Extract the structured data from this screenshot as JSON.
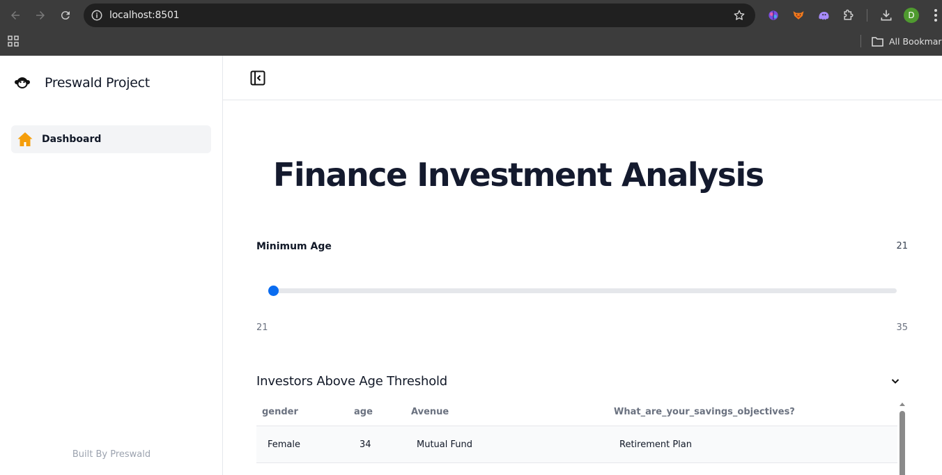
{
  "browser": {
    "url": "localhost:8501",
    "profile_initial": "D",
    "bookmarks_label": "All Bookmarks"
  },
  "sidebar": {
    "app_name": "Preswald Project",
    "items": [
      {
        "label": "Dashboard",
        "icon": "home-icon",
        "active": true
      }
    ],
    "footer": "Built By Preswald"
  },
  "main": {
    "title": "Finance Investment Analysis",
    "slider": {
      "label": "Minimum Age",
      "value": "21",
      "min": "21",
      "max": "35",
      "min_value": 21,
      "max_value": 35,
      "current_value": 21,
      "accent": "#0a6cf0"
    },
    "table_section": {
      "title": "Investors Above Age Threshold",
      "columns": [
        "gender",
        "age",
        "Avenue",
        "What_are_your_savings_objectives?"
      ],
      "rows": [
        [
          "Female",
          "34",
          "Mutual Fund",
          "Retirement Plan"
        ]
      ]
    }
  },
  "colors": {
    "title": "#141a2e",
    "home_icon": "#f59e0b",
    "nav_active_bg": "#f3f4f6"
  }
}
